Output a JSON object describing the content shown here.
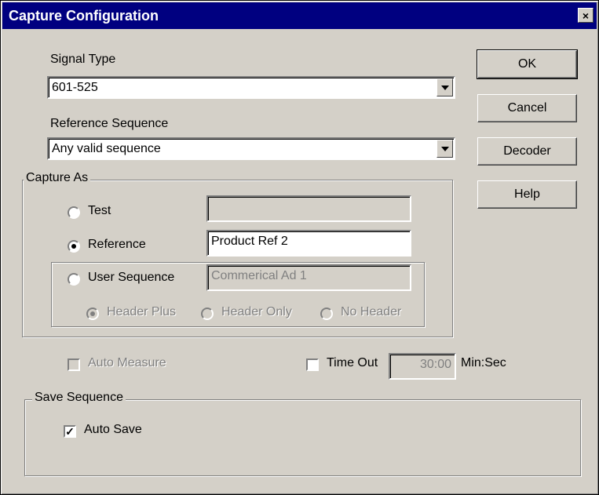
{
  "window": {
    "title": "Capture Configuration",
    "close_glyph": "×"
  },
  "signal_type": {
    "label": "Signal Type",
    "value": "601-525"
  },
  "reference_sequence": {
    "label": "Reference Sequence",
    "value": "Any valid sequence"
  },
  "buttons": {
    "ok": "OK",
    "cancel": "Cancel",
    "decoder": "Decoder",
    "help": "Help"
  },
  "capture_as": {
    "title": "Capture As",
    "test": {
      "label": "Test",
      "value": ""
    },
    "reference": {
      "label": "Reference",
      "value": "Product Ref 2",
      "selected": true
    },
    "user_sequence": {
      "label": "User Sequence",
      "value": "Commerical Ad 1"
    },
    "header_plus": "Header Plus",
    "header_only": "Header Only",
    "no_header": "No Header"
  },
  "auto_measure": {
    "label": "Auto Measure",
    "checked": false
  },
  "time_out": {
    "label": "Time Out",
    "value": "30:00",
    "unit": "Min:Sec",
    "checked": false
  },
  "save_sequence": {
    "title": "Save Sequence",
    "auto_save": {
      "label": "Auto Save",
      "checked": true,
      "mark": "✓"
    }
  }
}
